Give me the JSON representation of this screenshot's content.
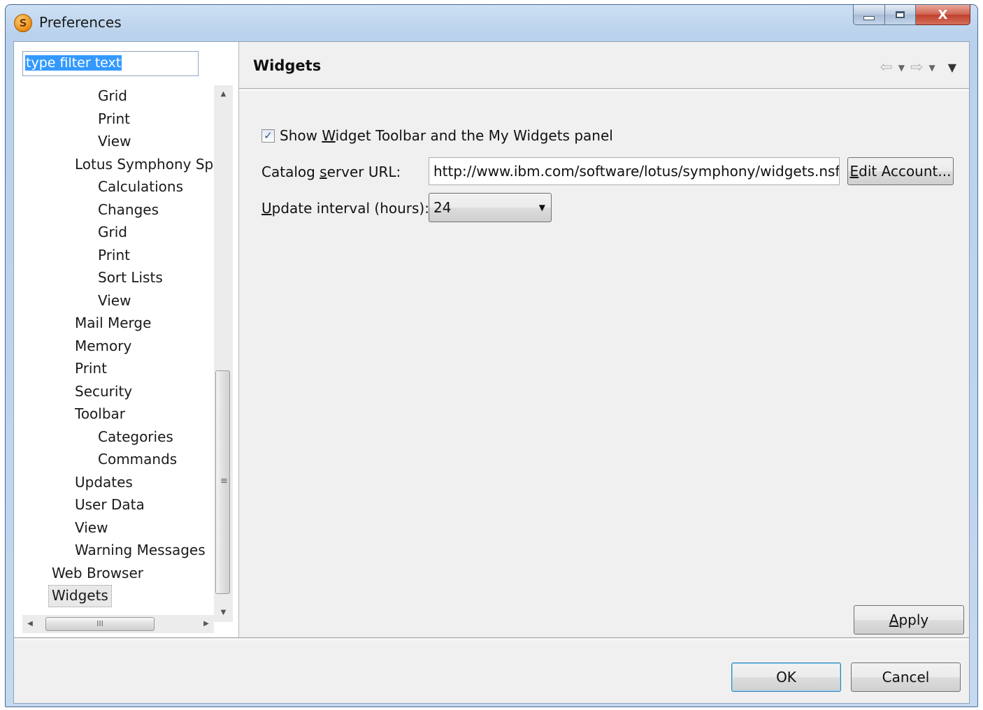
{
  "window": {
    "title": "Preferences",
    "app_icon_letter": "S",
    "close_glyph": "X"
  },
  "sidebar": {
    "filter_text": "type filter text",
    "tree": [
      {
        "label": "Grid",
        "level": 3
      },
      {
        "label": "Print",
        "level": 3
      },
      {
        "label": "View",
        "level": 3
      },
      {
        "label": "Lotus Symphony Spre",
        "level": 2
      },
      {
        "label": "Calculations",
        "level": 3
      },
      {
        "label": "Changes",
        "level": 3
      },
      {
        "label": "Grid",
        "level": 3
      },
      {
        "label": "Print",
        "level": 3
      },
      {
        "label": "Sort Lists",
        "level": 3
      },
      {
        "label": "View",
        "level": 3
      },
      {
        "label": "Mail Merge",
        "level": 2
      },
      {
        "label": "Memory",
        "level": 2
      },
      {
        "label": "Print",
        "level": 2
      },
      {
        "label": "Security",
        "level": 2
      },
      {
        "label": "Toolbar",
        "level": 2
      },
      {
        "label": "Categories",
        "level": 3
      },
      {
        "label": "Commands",
        "level": 3
      },
      {
        "label": "Updates",
        "level": 2
      },
      {
        "label": "User Data",
        "level": 2
      },
      {
        "label": "View",
        "level": 2
      },
      {
        "label": "Warning Messages",
        "level": 2
      },
      {
        "label": "Web Browser",
        "level": 1
      },
      {
        "label": "Widgets",
        "level": 1,
        "selected": true
      }
    ],
    "hscroll_grip": "III"
  },
  "page": {
    "title": "Widgets",
    "show_toolbar": {
      "checked": true,
      "label_pre": "Show ",
      "label_mnemonic": "W",
      "label_post": "idget Toolbar and the My Widgets panel"
    },
    "catalog": {
      "label_pre": "Catalog ",
      "label_mnemonic": "s",
      "label_post": "erver URL:",
      "value": "http://www.ibm.com/software/lotus/symphony/widgets.nsf"
    },
    "edit_account": {
      "mnemonic": "E",
      "rest": "dit Account..."
    },
    "interval": {
      "label_mnemonic": "U",
      "label_post": "pdate interval (hours):",
      "value": "24"
    },
    "apply": {
      "mnemonic": "A",
      "rest": "pply"
    }
  },
  "footer": {
    "ok_label": "OK",
    "cancel_label": "Cancel"
  }
}
